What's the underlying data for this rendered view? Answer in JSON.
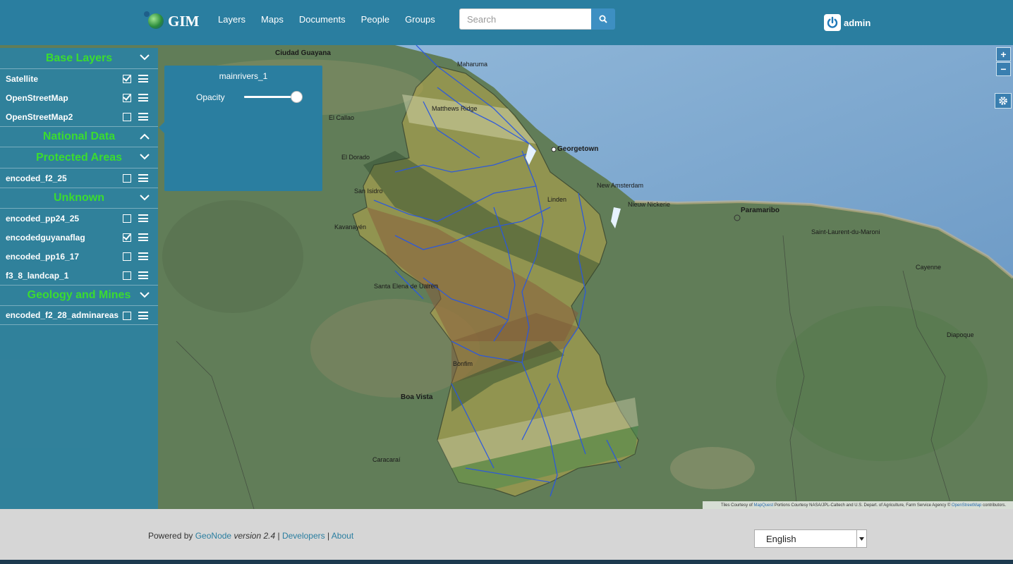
{
  "navbar": {
    "brand": "GIM",
    "links": [
      "Layers",
      "Maps",
      "Documents",
      "People",
      "Groups"
    ],
    "search_placeholder": "Search",
    "user": "admin"
  },
  "sidebar": {
    "groups": [
      {
        "title": "Base Layers",
        "expanded": true,
        "layers": [
          {
            "name": "Satellite",
            "checked": true
          },
          {
            "name": "OpenStreetMap",
            "checked": true
          },
          {
            "name": "OpenStreetMap2",
            "checked": false
          }
        ]
      },
      {
        "title": "National Data",
        "expanded": false,
        "layers": []
      },
      {
        "title": "Protected Areas",
        "expanded": true,
        "layers": [
          {
            "name": "encoded_f2_25",
            "checked": false
          }
        ]
      },
      {
        "title": "Unknown",
        "expanded": true,
        "layers": [
          {
            "name": "encoded_pp24_25",
            "checked": false
          },
          {
            "name": "encodedguyanaflag",
            "checked": true
          },
          {
            "name": "encoded_pp16_17",
            "checked": false
          },
          {
            "name": "f3_8_landcap_1",
            "checked": false
          }
        ]
      },
      {
        "title": "Geology and Mines",
        "expanded": true,
        "layers": [
          {
            "name": "encoded_f2_28_adminareas",
            "checked": false
          }
        ]
      }
    ]
  },
  "layer_panel": {
    "title": "mainrivers_1",
    "opacity_label": "Opacity",
    "opacity_value": 0.95
  },
  "map": {
    "zoom_in": "+",
    "zoom_out": "−",
    "places": [
      "Ciudad Guayana",
      "Maharuma",
      "Matthews Ridge",
      "El Callao",
      "Georgetown",
      "El Dorado",
      "San Isidro",
      "New Amsterdam",
      "Linden",
      "Nieuw Nickerie",
      "Paramaribo",
      "Kavanayén",
      "Saint-Laurent-du-Maroni",
      "Cayenne",
      "Santa Elena de Uairén",
      "Bonfim",
      "Boa Vista",
      "Caracaraí",
      "Diapoque"
    ],
    "attribution": {
      "prefix": "Tiles Courtesy of",
      "mapquest": "MapQuest",
      "middle": "Portions Courtesy NASA/JPL-Caltech and U.S. Depart. of Agriculture, Farm Service Agency ©",
      "osm": "OpenStreetMap",
      "suffix": "contributors."
    }
  },
  "footer": {
    "powered_by": "Powered by",
    "geonode": "GeoNode",
    "version": "version 2.4",
    "sep1": "|",
    "developers": "Developers",
    "sep2": "|",
    "about": "About",
    "language": "English"
  }
}
